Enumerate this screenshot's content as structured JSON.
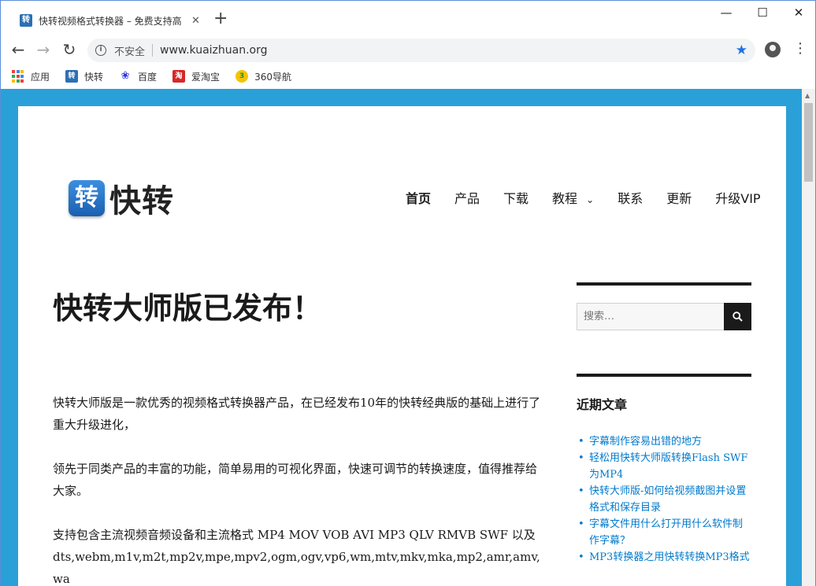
{
  "browser": {
    "tab_title": "快转视频格式转换器 – 免费支持高",
    "tab_favicon": "转",
    "url_security": "不安全",
    "url": "www.kuaizhuan.org",
    "bookmarks": [
      {
        "label": "应用",
        "icon": "apps-grid-icon"
      },
      {
        "label": "快转",
        "icon": "kuaizhuan-icon"
      },
      {
        "label": "百度",
        "icon": "baidu-paw-icon"
      },
      {
        "label": "爱淘宝",
        "icon": "taobao-icon"
      },
      {
        "label": "360导航",
        "icon": "360-icon"
      }
    ]
  },
  "site": {
    "logo_badge": "转",
    "logo_text": "快转",
    "nav": [
      "首页",
      "产品",
      "下载",
      "教程",
      "联系",
      "更新",
      "升级VIP"
    ],
    "headline": "快转大师版已发布！",
    "paragraphs": [
      "快转大师版是一款优秀的视频格式转换器产品，在已经发布10年的快转经典版的基础上进行了重大升级进化，",
      "领先于同类产品的丰富的功能，简单易用的可视化界面，快速可调节的转换速度，值得推荐给大家。",
      "支持包含主流视频音频设备和主流格式 MP4 MOV VOB AVI MP3 QLV RMVB SWF 以及dts,webm,m1v,m2t,mp2v,mpe,mpv2,ogm,ogv,vp6,wm,mtv,mkv,mka,mp2,amr,amv,wa"
    ],
    "search_placeholder": "搜索…",
    "recent_title": "近期文章",
    "recent_posts": [
      "字幕制作容易出错的地方",
      "轻松用快转大师版转换Flash SWF为MP4",
      "快转大师版-如何给视频截图并设置格式和保存目录",
      "字幕文件用什么打开用什么软件制作字幕？",
      "MP3转换器之用快转转换MP3格式"
    ]
  },
  "colors": {
    "background": "#2aa0d8",
    "link": "#007acc",
    "accent": "#1a73e8"
  }
}
